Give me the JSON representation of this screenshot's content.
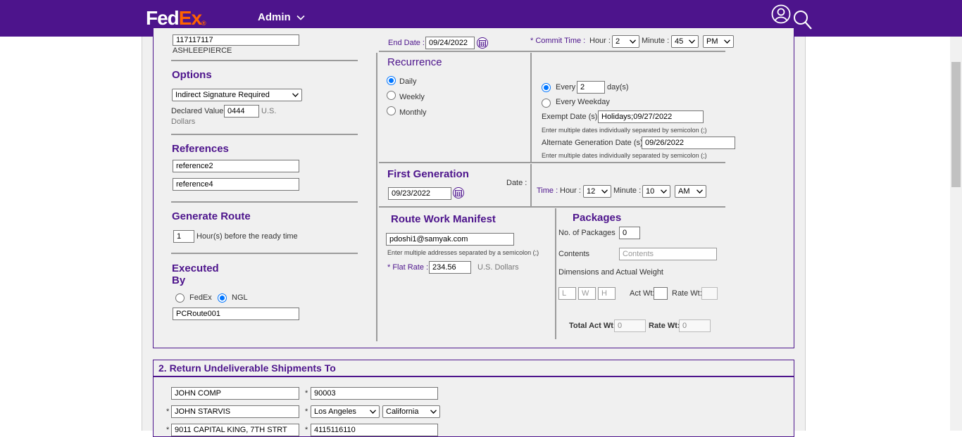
{
  "header": {
    "logo_fed": "Fed",
    "logo_ex": "Ex",
    "logo_dot": "®",
    "menu_label": "Admin",
    "brand_color": "#4d148c",
    "accent_color": "#ff6200"
  },
  "left": {
    "account_value": "117117117",
    "account_name": "ASHLEEPIERCE",
    "options_title": "Options",
    "signature_option": "Indirect Signature Required",
    "declared_value_label": "Declared Value",
    "declared_value": "0444",
    "declared_unit_1": "U.S.",
    "declared_unit_2": "Dollars",
    "references_title": "References",
    "reference_1": "reference2",
    "reference_2": "reference4",
    "generate_route_title": "Generate Route",
    "hours_before": "1",
    "hours_before_label": "Hour(s) before the ready time",
    "executed_by_title_1": "Executed",
    "executed_by_title_2": "By",
    "executed_fedex": "FedEx",
    "executed_ngl": "NGL",
    "route_name": "PCRoute001"
  },
  "schedule": {
    "end_date_label": "End Date :",
    "end_date": "09/24/2022",
    "commit_time_label": "* Commit Time :",
    "hour_label": "Hour :",
    "commit_hour": "2",
    "minute_label": "Minute :",
    "commit_minute": "45",
    "commit_ampm": "PM"
  },
  "recurrence": {
    "title": "Recurrence",
    "daily": "Daily",
    "weekly": "Weekly",
    "monthly": "Monthly",
    "every_label": "Every",
    "every_days": "2",
    "days_unit": "day(s)",
    "every_weekday": "Every Weekday",
    "exempt_label": "Exempt Date (s)",
    "exempt_value": "Holidays;09/27/2022",
    "exempt_help": "Enter multiple dates individually separated by semicolon (;)",
    "alt_label": "Alternate Generation Date (s)",
    "alt_value": "09/26/2022",
    "alt_help": "Enter multiple dates individually separated by semicolon (;)"
  },
  "first_generation": {
    "title": "First Generation",
    "date_label": "Date :",
    "date": "09/23/2022",
    "time_label": "Time :",
    "hour_label": "Hour :",
    "hour": "12",
    "minute_label": "Minute :",
    "minute": "10",
    "ampm": "AM"
  },
  "manifest": {
    "title": "Route Work Manifest",
    "email": "pdoshi1@samyak.com",
    "email_help": "Enter multiple addresses separated by a semicolon (;)",
    "flat_rate_label": "* Flat Rate :",
    "flat_rate": "234.56",
    "flat_rate_unit": "U.S. Dollars"
  },
  "packages": {
    "title": "Packages",
    "count_label": "No. of Packages",
    "count": "0",
    "contents_label": "Contents",
    "contents_placeholder": "Contents",
    "dims_label": "Dimensions and Actual Weight",
    "l_ph": "L",
    "w_ph": "W",
    "h_ph": "H",
    "act_wt_label": "Act Wt:",
    "rate_wt_label": "Rate Wt:",
    "total_act_label": "Total Act Wt:",
    "total_act": "0",
    "total_rate_label": "Rate Wt:",
    "total_rate": "0"
  },
  "return_section": {
    "title": "2. Return Undeliverable Shipments To",
    "company": "JOHN COMP",
    "zip": "90003",
    "contact": "JOHN STARVIS",
    "city": "Los Angeles",
    "state": "California",
    "address": "9011 CAPITAL KING, 7TH STRT",
    "phone": "4115116110",
    "req_mark": "*"
  }
}
